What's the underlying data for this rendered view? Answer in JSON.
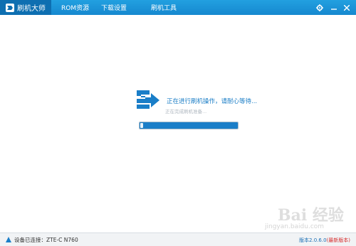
{
  "app": {
    "title": "刷机大师",
    "logo_icon": "flash-master-logo-icon"
  },
  "tabs": [
    {
      "label": "ROM资源"
    },
    {
      "label": "下载设置"
    },
    {
      "label": "刷机工具"
    }
  ],
  "window_controls": [
    "settings-icon",
    "minimize-icon",
    "close-icon"
  ],
  "status": {
    "main": "正在进行刷机操作，请耐心等待...",
    "sub": "正在完成刷机准备..."
  },
  "progress": {
    "value": 0.04
  },
  "statusbar": {
    "connection_prefix": "设备已连接：",
    "device": "ZTE-C N760",
    "version": "版本2.0.6.0",
    "version_tag": "(最新版本)"
  },
  "watermark": {
    "text": "Bai 经验",
    "sub": "jingyan.baidu.com"
  },
  "colors": {
    "titlebar": "#1688cf",
    "accent": "#1a7ec8",
    "version_tag": "#d62a2a"
  }
}
